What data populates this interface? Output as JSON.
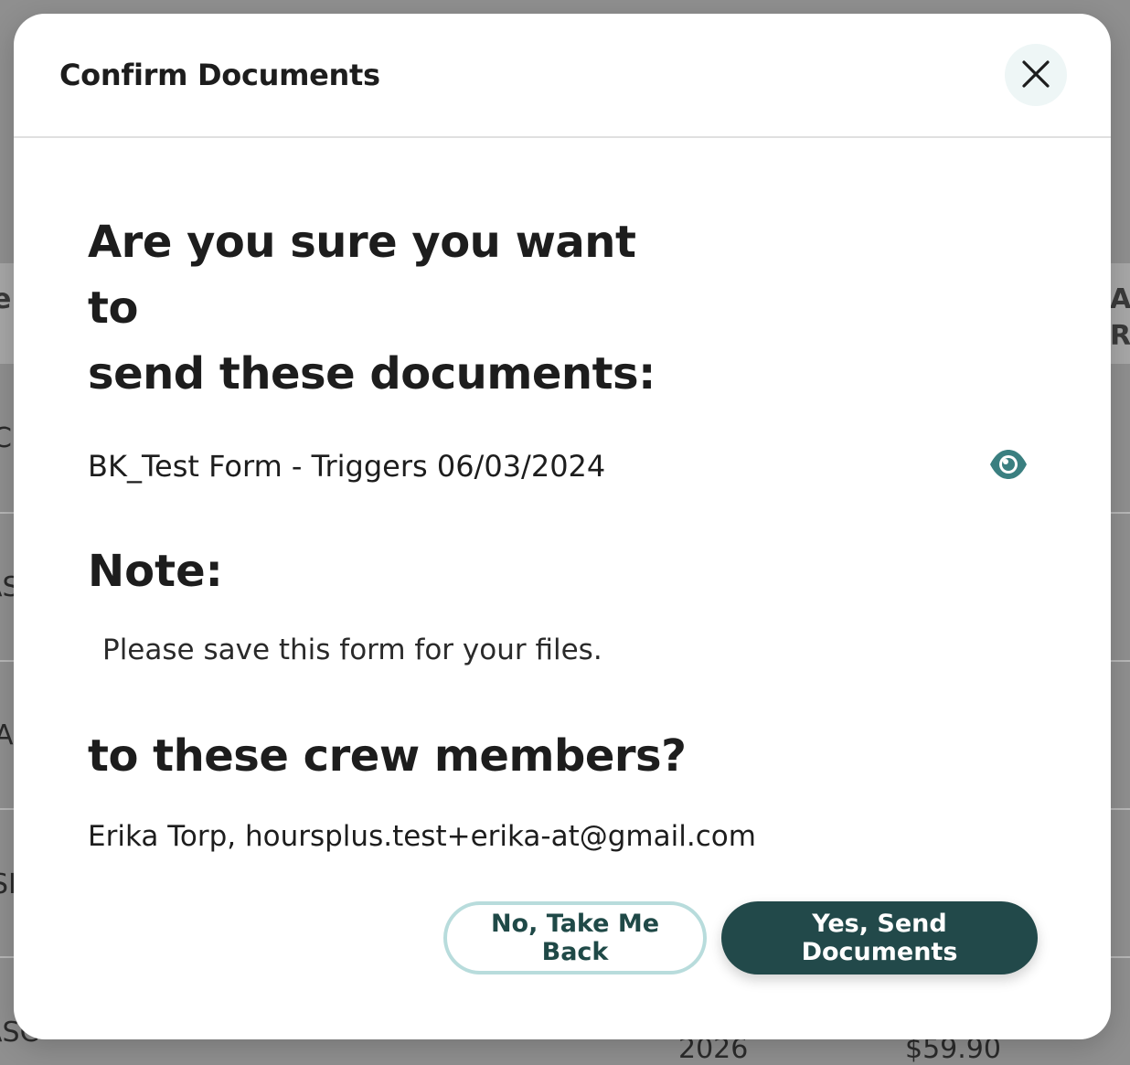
{
  "background": {
    "fragments": [
      "e",
      "C",
      "AS",
      "A",
      "SI",
      "ASC",
      "AI",
      "Re",
      "2026",
      "$59.90"
    ]
  },
  "modal": {
    "title": "Confirm Documents",
    "close_icon": "close-icon",
    "question_line1": "Are you sure you want to",
    "question_line2": "send these documents:",
    "document_name": "BK_Test Form - Triggers 06/03/2024",
    "view_icon": "eye-icon",
    "note_heading": "Note:",
    "note_text": "Please save this form for your files.",
    "crew_heading": "to these crew members?",
    "crew_list": "Erika Torp, hoursplus.test+erika-at@gmail.com",
    "cancel_label": "No, Take Me Back",
    "confirm_label": "Yes, Send Documents"
  },
  "colors": {
    "primary": "#22494a",
    "secondary_border": "#b8dcdc",
    "eye_icon": "#3a7f80",
    "overlay": "#8f8f8f"
  }
}
